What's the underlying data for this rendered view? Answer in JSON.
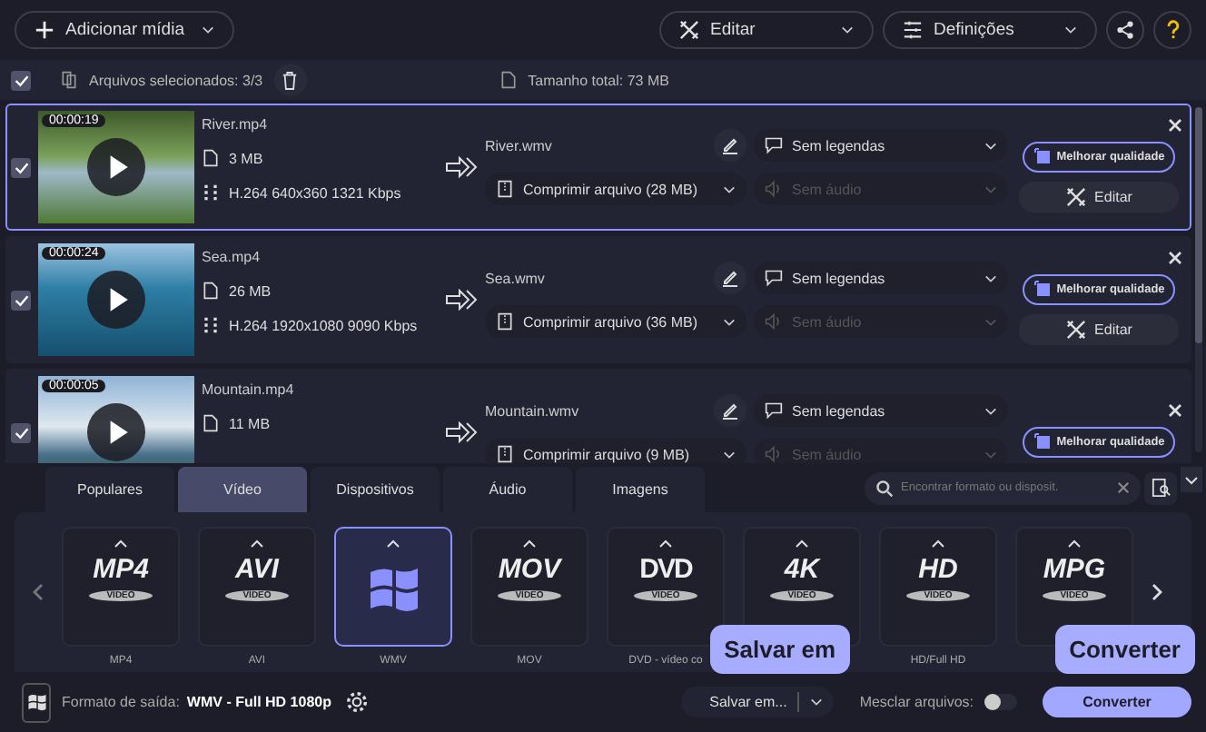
{
  "toolbar": {
    "add_media": "Adicionar mídia",
    "edit": "Editar",
    "settings": "Definições"
  },
  "selection_bar": {
    "checked": true,
    "selected_label": "Arquivos selecionados: 3/3",
    "total_size": "Tamanho total: 73 MB"
  },
  "files": [
    {
      "checked": true,
      "selected": true,
      "duration": "00:00:19",
      "name": "River.mp4",
      "size": "3 MB",
      "meta": "H.264 640x360 1321 Kbps",
      "output": "River.wmv",
      "compress": "Comprimir arquivo (28 MB)",
      "subtitles": "Sem legendas",
      "audio": "Sem áudio",
      "audio_disabled": true,
      "quality": "Melhorar qualidade",
      "edit": "Editar"
    },
    {
      "checked": true,
      "selected": false,
      "duration": "00:00:24",
      "name": "Sea.mp4",
      "size": "26 MB",
      "meta": "H.264 1920x1080 9090 Kbps",
      "output": "Sea.wmv",
      "compress": "Comprimir arquivo (36 MB)",
      "subtitles": "Sem legendas",
      "audio": "Sem áudio",
      "audio_disabled": true,
      "quality": "Melhorar qualidade",
      "edit": "Editar"
    },
    {
      "checked": true,
      "selected": false,
      "duration": "00:00:05",
      "name": "Mountain.mp4",
      "size": "11 MB",
      "output": "Mountain.wmv",
      "compress": "Comprimir arquivo (9 MB)",
      "subtitles": "Sem legendas",
      "audio": "Sem áudio",
      "audio_disabled": true,
      "quality": "Melhorar qualidade"
    }
  ],
  "tabs": [
    {
      "label": "Populares",
      "selected": false
    },
    {
      "label": "Vídeo",
      "selected": true
    },
    {
      "label": "Dispositivos",
      "selected": false
    },
    {
      "label": "Áudio",
      "selected": false
    },
    {
      "label": "Imagens",
      "selected": false
    }
  ],
  "search": {
    "placeholder": "Encontrar formato ou disposit."
  },
  "formats": [
    {
      "kind": "text",
      "logo": "MP4",
      "sub": "VIDEO",
      "label": "MP4",
      "selected": false
    },
    {
      "kind": "text",
      "logo": "AVI",
      "sub": "VIDEO",
      "label": "AVI",
      "selected": false
    },
    {
      "kind": "windows",
      "label": "WMV",
      "selected": true
    },
    {
      "kind": "text",
      "logo": "MOV",
      "sub": "VIDEO",
      "label": "MOV",
      "selected": false
    },
    {
      "kind": "disc",
      "logo": "DVD",
      "sub": "VIDEO",
      "label": "DVD - vídeo co",
      "selected": false
    },
    {
      "kind": "text",
      "logo": "4K",
      "sub": "VIDEO",
      "selected": false
    },
    {
      "kind": "text",
      "logo": "HD",
      "sub": "VIDEO",
      "label": "HD/Full HD",
      "selected": false
    },
    {
      "kind": "text",
      "logo": "MPG",
      "sub": "VIDEO",
      "selected": false
    }
  ],
  "bottom_bar": {
    "output_label": "Formato de saída:",
    "output_value": "WMV - Full HD 1080p",
    "save_to": "Salvar em...",
    "save_tooltip": "Salvar em",
    "merge_label": "Mesclar arquivos:",
    "merge_on": false,
    "convert": "Converter",
    "convert_tooltip": "Converter"
  }
}
